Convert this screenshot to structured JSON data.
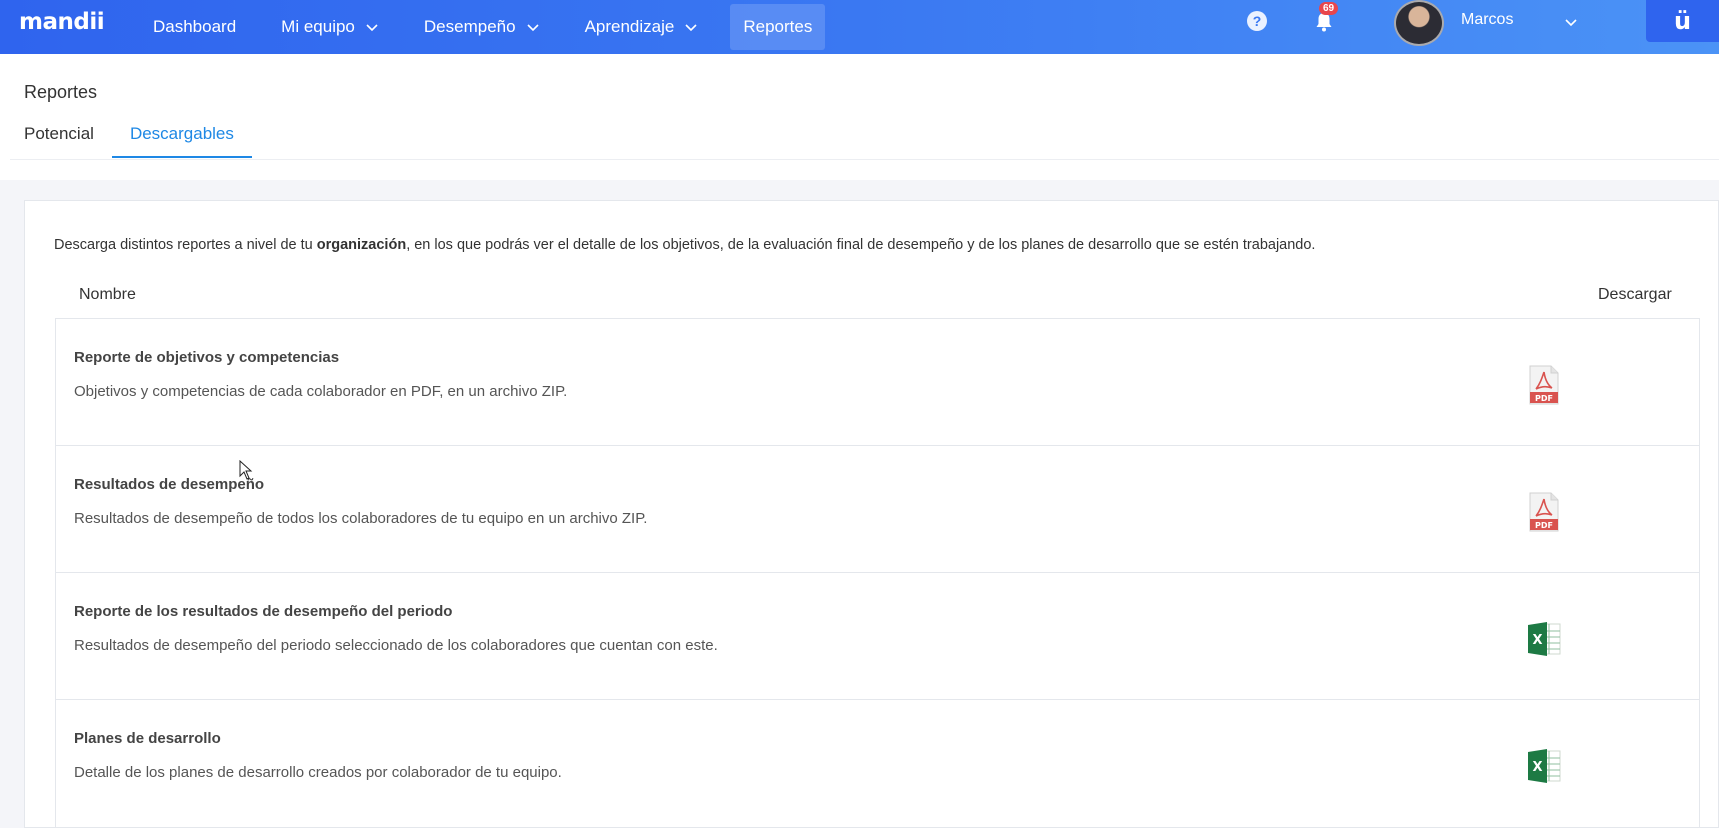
{
  "app": {
    "logo": "mandii",
    "brand_mark": "ü"
  },
  "nav": {
    "items": [
      {
        "label": "Dashboard",
        "has_menu": false,
        "active": false
      },
      {
        "label": "Mi equipo",
        "has_menu": true,
        "active": false
      },
      {
        "label": "Desempeño",
        "has_menu": true,
        "active": false
      },
      {
        "label": "Aprendizaje",
        "has_menu": true,
        "active": false
      },
      {
        "label": "Reportes",
        "has_menu": false,
        "active": true
      }
    ]
  },
  "topbar": {
    "help_glyph": "?",
    "notification_count": "69",
    "user_name": "Marcos"
  },
  "page": {
    "title": "Reportes",
    "tabs": [
      {
        "label": "Potencial",
        "active": false
      },
      {
        "label": "Descargables",
        "active": true
      }
    ]
  },
  "content": {
    "intro_before": "Descarga distintos reportes a nivel de tu ",
    "intro_bold": "organización",
    "intro_after": ", en los que podrás ver el detalle de los objetivos, de la evaluación final de desempeño y de los planes de desarrollo que se estén trabajando.",
    "col_name": "Nombre",
    "col_download": "Descargar",
    "reports": [
      {
        "title": "Reporte de objetivos y competencias",
        "description": "Objetivos y competencias de cada colaborador en PDF, en un archivo ZIP.",
        "icon": "pdf-icon",
        "icon_label": "PDF"
      },
      {
        "title": "Resultados de desempeño",
        "description": "Resultados de desempeño de todos los colaboradores de tu equipo en un archivo ZIP.",
        "icon": "pdf-icon",
        "icon_label": "PDF"
      },
      {
        "title": "Reporte de los resultados de desempeño del periodo",
        "description": "Resultados de desempeño del periodo seleccionado de los colaboradores que cuentan con este.",
        "icon": "excel-icon",
        "icon_label": "X"
      },
      {
        "title": "Planes de desarrollo",
        "description": "Detalle de los planes de desarrollo creados por colaborador de tu equipo.",
        "icon": "excel-icon",
        "icon_label": "X"
      }
    ]
  },
  "colors": {
    "accent": "#1e88e5",
    "topbar_start": "#2f64ee",
    "topbar_end": "#4b93f6",
    "pdf_red": "#d9534f",
    "excel_green": "#1d7a44",
    "badge": "#e8464c"
  }
}
